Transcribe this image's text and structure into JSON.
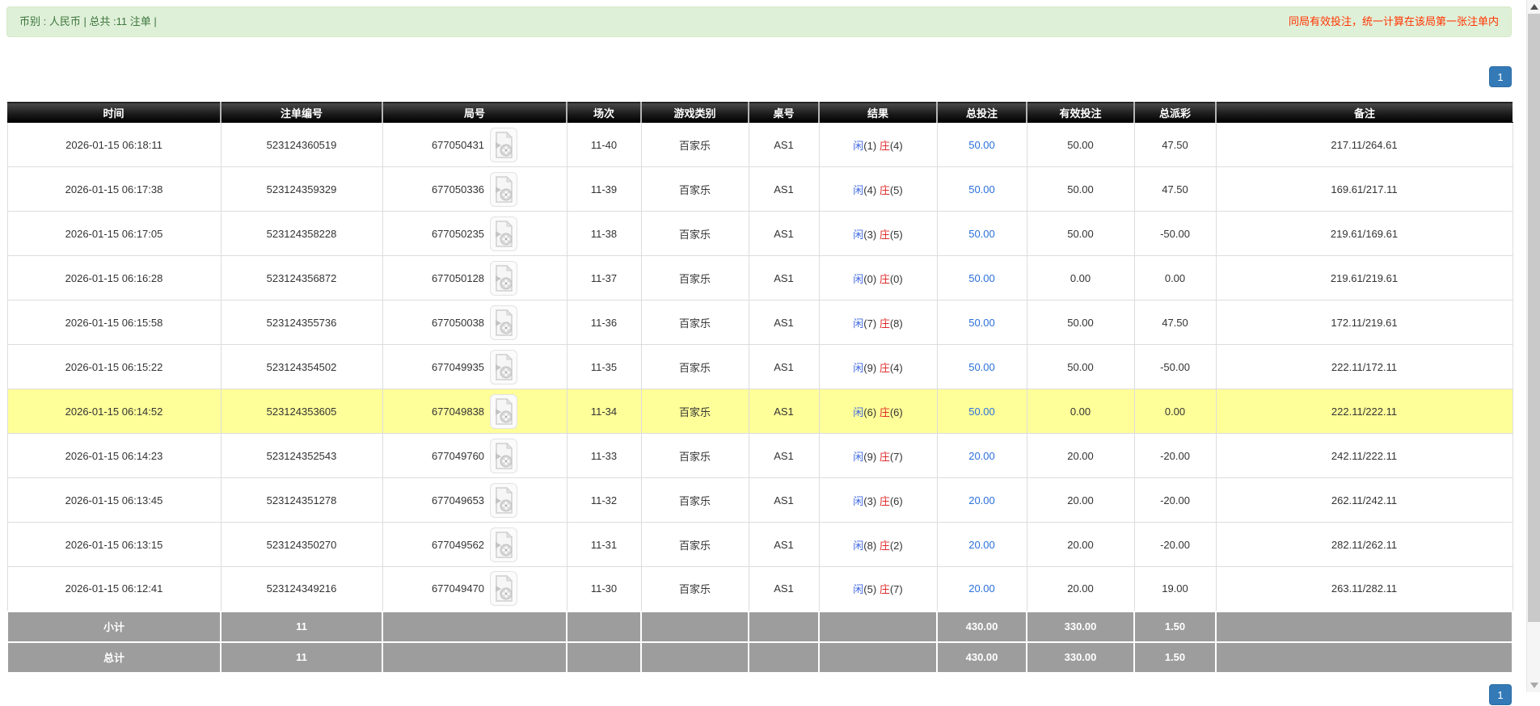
{
  "alert": {
    "summary_text": "币别 : 人民币 | 总共 :11 注单 |",
    "notice_text": "同局有效投注，统一计算在该局第一张注单内"
  },
  "pagination": {
    "current_page": "1"
  },
  "table": {
    "headers": [
      "时间",
      "注单编号",
      "局号",
      "场次",
      "游戏类别",
      "桌号",
      "结果",
      "总投注",
      "有效投注",
      "总派彩",
      "备注"
    ],
    "result_labels": {
      "player": "闲",
      "banker": "庄"
    },
    "rows": [
      {
        "time": "2026-01-15 06:18:11",
        "bet_no": "523124360519",
        "round_no": "677050431",
        "session": "11-40",
        "game": "百家乐",
        "table_no": "AS1",
        "result": {
          "player": "(1)",
          "banker": "(4)"
        },
        "total_bet": "50.00",
        "valid_bet": "50.00",
        "total_payout": "47.50",
        "remark": "217.11/264.61",
        "highlighted": false
      },
      {
        "time": "2026-01-15 06:17:38",
        "bet_no": "523124359329",
        "round_no": "677050336",
        "session": "11-39",
        "game": "百家乐",
        "table_no": "AS1",
        "result": {
          "player": "(4)",
          "banker": "(5)"
        },
        "total_bet": "50.00",
        "valid_bet": "50.00",
        "total_payout": "47.50",
        "remark": "169.61/217.11",
        "highlighted": false
      },
      {
        "time": "2026-01-15 06:17:05",
        "bet_no": "523124358228",
        "round_no": "677050235",
        "session": "11-38",
        "game": "百家乐",
        "table_no": "AS1",
        "result": {
          "player": "(3)",
          "banker": "(5)"
        },
        "total_bet": "50.00",
        "valid_bet": "50.00",
        "total_payout": "-50.00",
        "remark": "219.61/169.61",
        "highlighted": false
      },
      {
        "time": "2026-01-15 06:16:28",
        "bet_no": "523124356872",
        "round_no": "677050128",
        "session": "11-37",
        "game": "百家乐",
        "table_no": "AS1",
        "result": {
          "player": "(0)",
          "banker": "(0)"
        },
        "total_bet": "50.00",
        "valid_bet": "0.00",
        "total_payout": "0.00",
        "remark": "219.61/219.61",
        "highlighted": false
      },
      {
        "time": "2026-01-15 06:15:58",
        "bet_no": "523124355736",
        "round_no": "677050038",
        "session": "11-36",
        "game": "百家乐",
        "table_no": "AS1",
        "result": {
          "player": "(7)",
          "banker": "(8)"
        },
        "total_bet": "50.00",
        "valid_bet": "50.00",
        "total_payout": "47.50",
        "remark": "172.11/219.61",
        "highlighted": false
      },
      {
        "time": "2026-01-15 06:15:22",
        "bet_no": "523124354502",
        "round_no": "677049935",
        "session": "11-35",
        "game": "百家乐",
        "table_no": "AS1",
        "result": {
          "player": "(9)",
          "banker": "(4)"
        },
        "total_bet": "50.00",
        "valid_bet": "50.00",
        "total_payout": "-50.00",
        "remark": "222.11/172.11",
        "highlighted": false
      },
      {
        "time": "2026-01-15 06:14:52",
        "bet_no": "523124353605",
        "round_no": "677049838",
        "session": "11-34",
        "game": "百家乐",
        "table_no": "AS1",
        "result": {
          "player": "(6)",
          "banker": "(6)"
        },
        "total_bet": "50.00",
        "valid_bet": "0.00",
        "total_payout": "0.00",
        "remark": "222.11/222.11",
        "highlighted": true
      },
      {
        "time": "2026-01-15 06:14:23",
        "bet_no": "523124352543",
        "round_no": "677049760",
        "session": "11-33",
        "game": "百家乐",
        "table_no": "AS1",
        "result": {
          "player": "(9)",
          "banker": "(7)"
        },
        "total_bet": "20.00",
        "valid_bet": "20.00",
        "total_payout": "-20.00",
        "remark": "242.11/222.11",
        "highlighted": false
      },
      {
        "time": "2026-01-15 06:13:45",
        "bet_no": "523124351278",
        "round_no": "677049653",
        "session": "11-32",
        "game": "百家乐",
        "table_no": "AS1",
        "result": {
          "player": "(3)",
          "banker": "(6)"
        },
        "total_bet": "20.00",
        "valid_bet": "20.00",
        "total_payout": "-20.00",
        "remark": "262.11/242.11",
        "highlighted": false
      },
      {
        "time": "2026-01-15 06:13:15",
        "bet_no": "523124350270",
        "round_no": "677049562",
        "session": "11-31",
        "game": "百家乐",
        "table_no": "AS1",
        "result": {
          "player": "(8)",
          "banker": "(2)"
        },
        "total_bet": "20.00",
        "valid_bet": "20.00",
        "total_payout": "-20.00",
        "remark": "282.11/262.11",
        "highlighted": false
      },
      {
        "time": "2026-01-15 06:12:41",
        "bet_no": "523124349216",
        "round_no": "677049470",
        "session": "11-30",
        "game": "百家乐",
        "table_no": "AS1",
        "result": {
          "player": "(5)",
          "banker": "(7)"
        },
        "total_bet": "20.00",
        "valid_bet": "20.00",
        "total_payout": "19.00",
        "remark": "263.11/282.11",
        "highlighted": false
      }
    ],
    "subtotal": {
      "label": "小计",
      "count": "11",
      "total_bet": "430.00",
      "valid_bet": "330.00",
      "total_payout": "1.50"
    },
    "grand_total": {
      "label": "总计",
      "count": "11",
      "total_bet": "430.00",
      "valid_bet": "330.00",
      "total_payout": "1.50"
    }
  },
  "colors": {
    "alert_bg": "#dff0d8",
    "alert_text": "#3c763d",
    "notice_red": "#ff3300",
    "pager_blue": "#337ab7",
    "link_blue": "#2a6fdb",
    "player_blue": "#4169e1",
    "banker_red": "#e02b2b",
    "negative_red": "#ff0000",
    "highlight_yellow": "#ffff99",
    "summary_grey": "#9d9d9d"
  }
}
